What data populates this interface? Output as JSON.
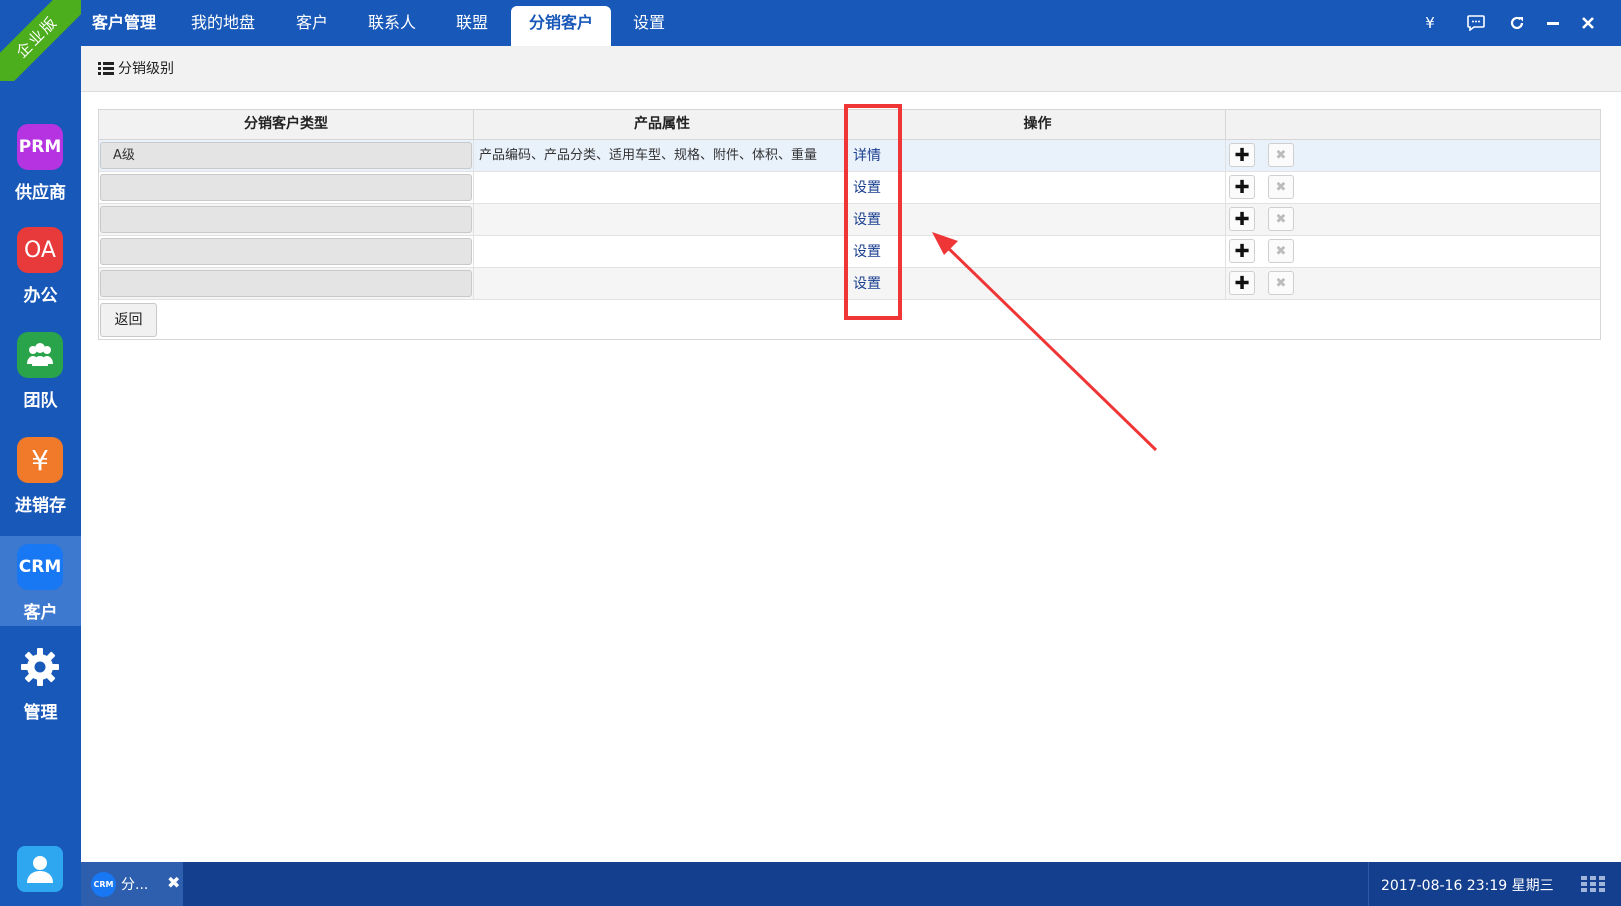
{
  "ribbon": {
    "label": "企业版"
  },
  "sidebar": {
    "items": [
      {
        "icon_text": "PRM",
        "label": "供应商",
        "color": "#b533e0",
        "icon": "prm-icon"
      },
      {
        "icon_text": "OA",
        "label": "办公",
        "color": "#e83a3a",
        "icon": "oa-icon"
      },
      {
        "icon_text": "",
        "label": "团队",
        "color": "#2aa44b",
        "icon": "team-icon"
      },
      {
        "icon_text": "¥",
        "label": "进销存",
        "color": "#f07a2a",
        "icon": "yen-icon"
      },
      {
        "icon_text": "CRM",
        "label": "客户",
        "color": "#1877f2",
        "icon": "crm-icon",
        "active": true
      },
      {
        "icon_text": "",
        "label": "管理",
        "color": "",
        "icon": "gear-icon"
      }
    ],
    "user_icon": "user-icon"
  },
  "topbar": {
    "tabs": [
      {
        "label": "客户管理"
      },
      {
        "label": "我的地盘"
      },
      {
        "label": "客户"
      },
      {
        "label": "联系人"
      },
      {
        "label": "联盟"
      },
      {
        "label": "分销客户",
        "active": true
      },
      {
        "label": "设置"
      }
    ],
    "window_buttons": {
      "currency": "¥",
      "chat": "chat-icon",
      "refresh": "refresh-icon",
      "minimize": "minimize-icon",
      "close": "close-icon"
    }
  },
  "toolbar": {
    "label": "分销级别"
  },
  "table": {
    "headers": [
      "分销客户类型",
      "产品属性",
      "操作"
    ],
    "rows": [
      {
        "type": "A级",
        "props": "产品编码、产品分类、适用车型、规格、附件、体积、重量",
        "action": "详情"
      },
      {
        "type": "",
        "props": "",
        "action": "设置"
      },
      {
        "type": "",
        "props": "",
        "action": "设置"
      },
      {
        "type": "",
        "props": "",
        "action": "设置"
      },
      {
        "type": "",
        "props": "",
        "action": "设置"
      }
    ],
    "add_symbol": "✚",
    "delete_symbol": "✖",
    "back_label": "返回"
  },
  "annotation": {
    "color": "#ef3535"
  },
  "bottombar": {
    "task_icon_text": "CRM",
    "task_label": "分...",
    "close_symbol": "✖",
    "clock": "2017-08-16 23:19 星期三"
  }
}
